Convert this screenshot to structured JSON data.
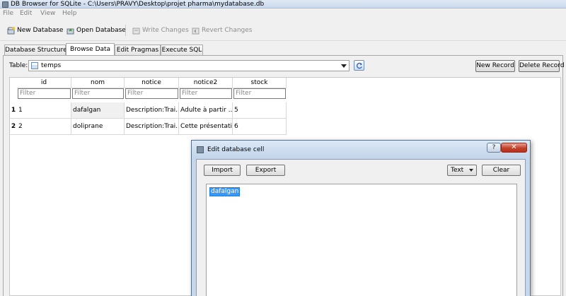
{
  "window": {
    "title": "DB Browser for SQLite - C:\\Users\\PRAVY\\Desktop\\projet pharma\\mydatabase.db"
  },
  "menu": [
    "File",
    "Edit",
    "View",
    "Help"
  ],
  "toolbar": {
    "new_database": "New Database",
    "open_database": "Open Database",
    "write_changes": "Write Changes",
    "revert_changes": "Revert Changes"
  },
  "tabs": [
    "Database Structure",
    "Browse Data",
    "Edit Pragmas",
    "Execute SQL"
  ],
  "active_tab": "Browse Data",
  "browse": {
    "table_label": "Table:",
    "table_selected": "temps",
    "new_record": "New Record",
    "delete_record": "Delete Record",
    "columns": [
      "id",
      "nom",
      "notice",
      "notice2",
      "stock"
    ],
    "filter_placeholder": "Filter",
    "rows": [
      {
        "num": "1",
        "cells": [
          "1",
          "dafalgan",
          "Description:Trai...",
          "Adulte à partir ...",
          "5"
        ]
      },
      {
        "num": "2",
        "cells": [
          "2",
          "doliprane",
          "Description:Trai...",
          "Cette présentati...",
          "6"
        ]
      }
    ]
  },
  "dialog": {
    "title": "Edit database cell",
    "help": "?",
    "close": "✕",
    "import": "Import",
    "export": "Export",
    "mode": "Text",
    "clear": "Clear",
    "content": "dafalgan"
  },
  "colors": {
    "selection": "#3399ff",
    "title_bar": "#c7d7ea",
    "close": "#c4402a"
  }
}
